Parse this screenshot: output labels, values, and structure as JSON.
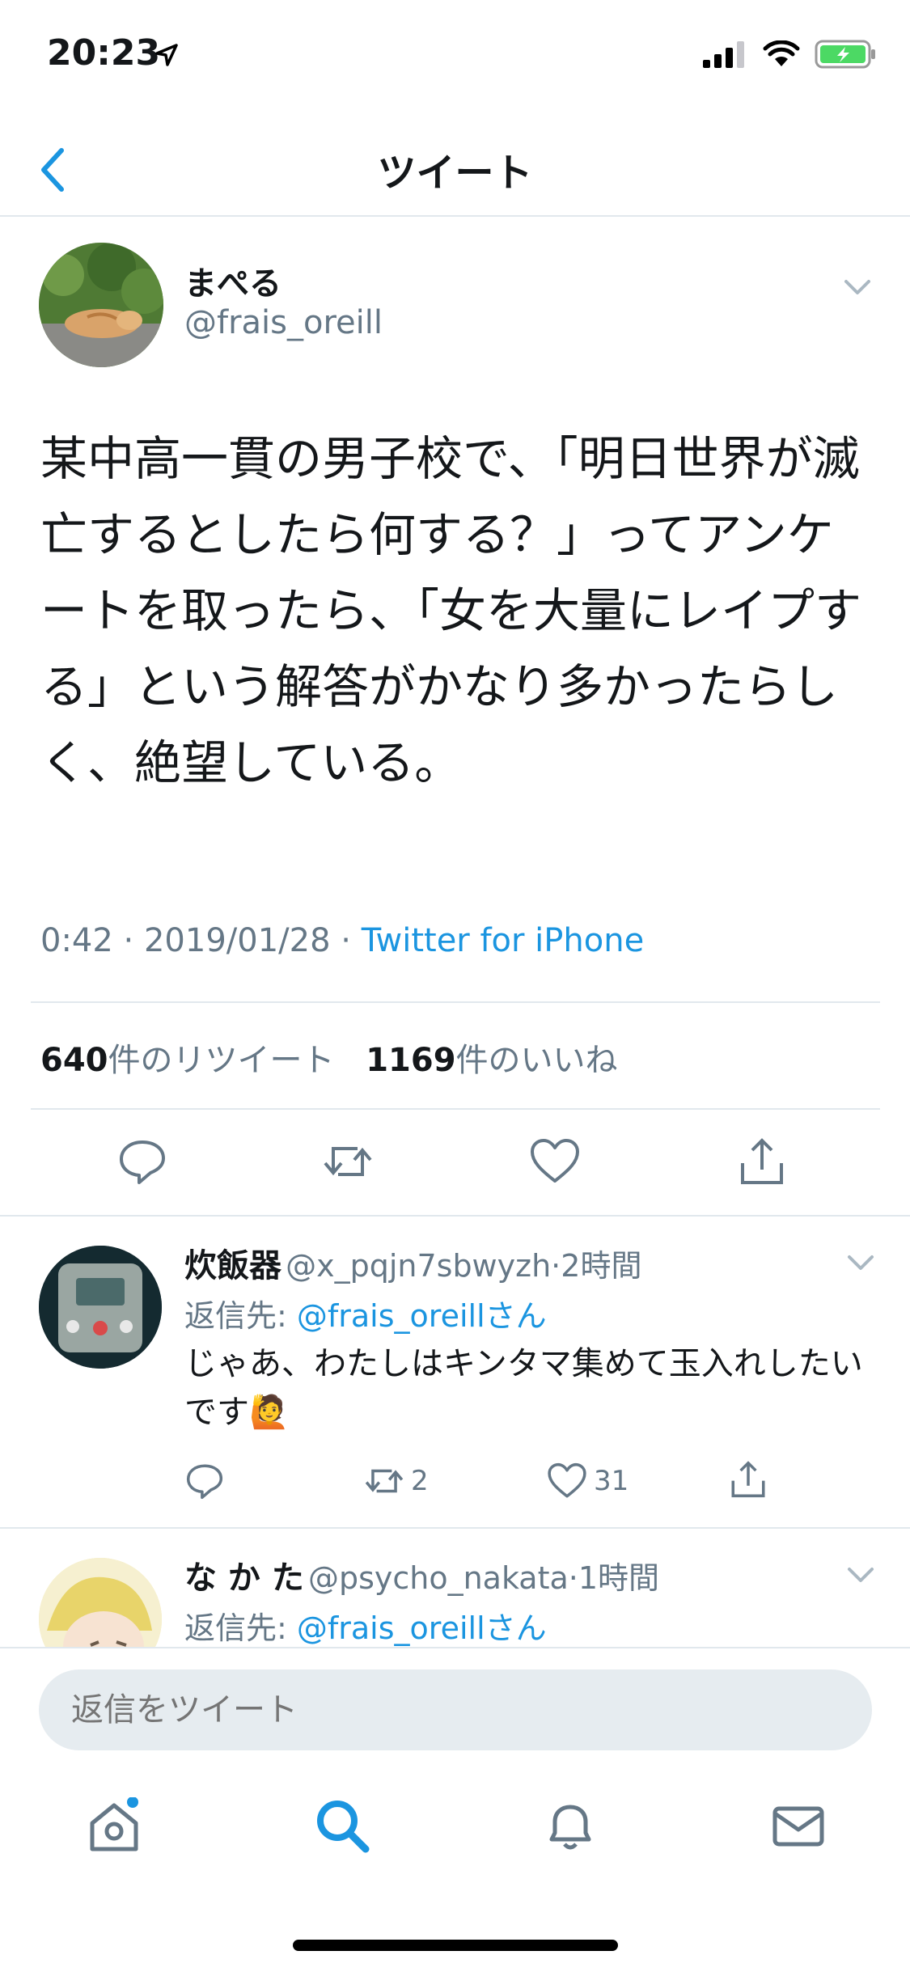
{
  "status_bar": {
    "time": "20:23"
  },
  "nav": {
    "title": "ツイート"
  },
  "main_tweet": {
    "name": "まぺる",
    "handle": "@frais_oreill",
    "text": "某中高一貫の男子校で、「明日世界が滅亡するとしたら何する？」ってアンケートを取ったら、「女を大量にレイプする」という解答がかなり多かったらしく、絶望している。",
    "time": "0:42",
    "date": "2019/01/28",
    "source": "Twitter for iPhone",
    "retweet_count": "640",
    "retweet_label": "件のリツイート",
    "like_count": "1169",
    "like_label": "件のいいね"
  },
  "replies": [
    {
      "name": "炊飯器",
      "handle": "@x_pqjn7sbwyzh",
      "age": "2時間",
      "reply_to_prefix": "返信先: ",
      "reply_to_handle": "@frais_oreillさん",
      "text": "じゃあ、わたしはキンタマ集めて玉入れしたいです🙋",
      "retweets": "2",
      "likes": "31"
    },
    {
      "name": "な か た",
      "handle": "@psycho_nakata",
      "age": "1時間",
      "reply_to_prefix": "返信先: ",
      "reply_to_handle": "@frais_oreillさん"
    }
  ],
  "compose": {
    "placeholder": "返信をツイート"
  },
  "colors": {
    "accent": "#1b95e0",
    "secondary_text": "#657786",
    "divider": "#e1e8ed"
  }
}
